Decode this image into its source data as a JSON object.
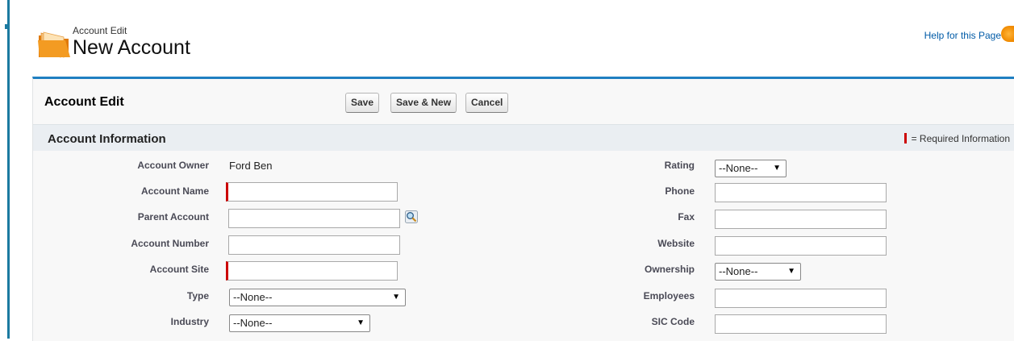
{
  "header": {
    "subtitle": "Account Edit",
    "title": "New Account",
    "help_link": "Help for this Page"
  },
  "block": {
    "title": "Account Edit",
    "buttons": {
      "save": "Save",
      "save_new": "Save & New",
      "cancel": "Cancel"
    }
  },
  "section": {
    "title": "Account Information",
    "required_legend": "= Required Information"
  },
  "fields_left": {
    "account_owner": {
      "label": "Account Owner",
      "value": "Ford Ben"
    },
    "account_name": {
      "label": "Account Name",
      "value": ""
    },
    "parent_account": {
      "label": "Parent Account",
      "value": ""
    },
    "account_number": {
      "label": "Account Number",
      "value": ""
    },
    "account_site": {
      "label": "Account Site",
      "value": ""
    },
    "type": {
      "label": "Type",
      "selected": "--None--"
    },
    "industry": {
      "label": "Industry",
      "selected": "--None--"
    }
  },
  "fields_right": {
    "rating": {
      "label": "Rating",
      "selected": "--None--"
    },
    "phone": {
      "label": "Phone",
      "value": ""
    },
    "fax": {
      "label": "Fax",
      "value": ""
    },
    "website": {
      "label": "Website",
      "value": ""
    },
    "ownership": {
      "label": "Ownership",
      "selected": "--None--"
    },
    "employees": {
      "label": "Employees",
      "value": ""
    },
    "sic_code": {
      "label": "SIC Code",
      "value": ""
    }
  },
  "icons": {
    "page": "folder-icon",
    "help": "help-icon",
    "lookup": "magnifier-lookup-icon",
    "dropdown": "triangle-down-icon"
  },
  "colors": {
    "accent": "#1f7fc1",
    "required": "#c00000",
    "link": "#015ba7"
  }
}
